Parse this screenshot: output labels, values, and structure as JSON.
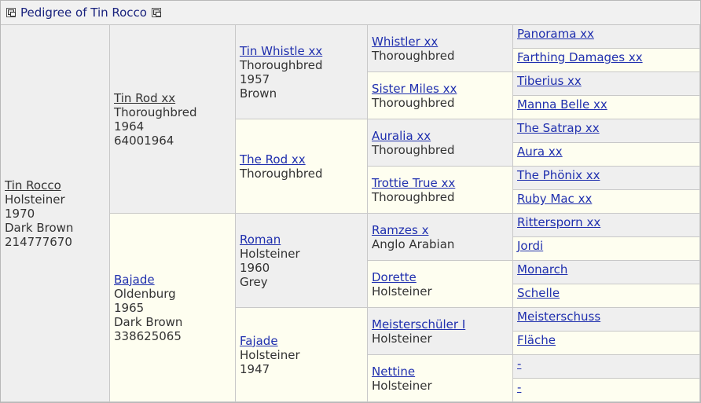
{
  "header": {
    "title": "Pedigree of Tin Rocco"
  },
  "horse": {
    "name": "Tin Rocco",
    "breed": "Holsteiner",
    "year": "1970",
    "color": "Dark Brown",
    "reg": "214777670"
  },
  "sire": {
    "name": "Tin Rod xx",
    "breed": "Thoroughbred",
    "year": "1964",
    "reg": "64001964"
  },
  "dam": {
    "name": "Bajade",
    "breed": "Oldenburg",
    "year": "1965",
    "color": "Dark Brown",
    "reg": "338625065"
  },
  "gen3": [
    {
      "name": "Tin Whistle xx",
      "breed": "Thoroughbred",
      "year": "1957",
      "color": "Brown"
    },
    {
      "name": "The Rod xx",
      "breed": "Thoroughbred"
    },
    {
      "name": "Roman",
      "breed": "Holsteiner",
      "year": "1960",
      "color": "Grey"
    },
    {
      "name": "Fajade",
      "breed": "Holsteiner",
      "year": "1947"
    }
  ],
  "gen4": [
    {
      "name": "Whistler xx",
      "breed": "Thoroughbred"
    },
    {
      "name": "Sister Miles xx",
      "breed": "Thoroughbred"
    },
    {
      "name": "Auralia xx",
      "breed": "Thoroughbred"
    },
    {
      "name": "Trottie True xx",
      "breed": "Thoroughbred"
    },
    {
      "name": "Ramzes x",
      "breed": "Anglo Arabian"
    },
    {
      "name": "Dorette",
      "breed": "Holsteiner"
    },
    {
      "name": "Meisterschüler I",
      "breed": "Holsteiner"
    },
    {
      "name": "Nettine",
      "breed": "Holsteiner"
    }
  ],
  "gen5": [
    "Panorama xx",
    "Farthing Damages xx",
    "Tiberius xx",
    "Manna Belle xx",
    "The Satrap xx",
    "Aura xx",
    "The Phönix xx",
    "Ruby Mac xx",
    "Rittersporn xx",
    "Jordi",
    "Monarch",
    "Schelle",
    "Meisterschuss",
    "Fläche",
    "-",
    "-"
  ]
}
